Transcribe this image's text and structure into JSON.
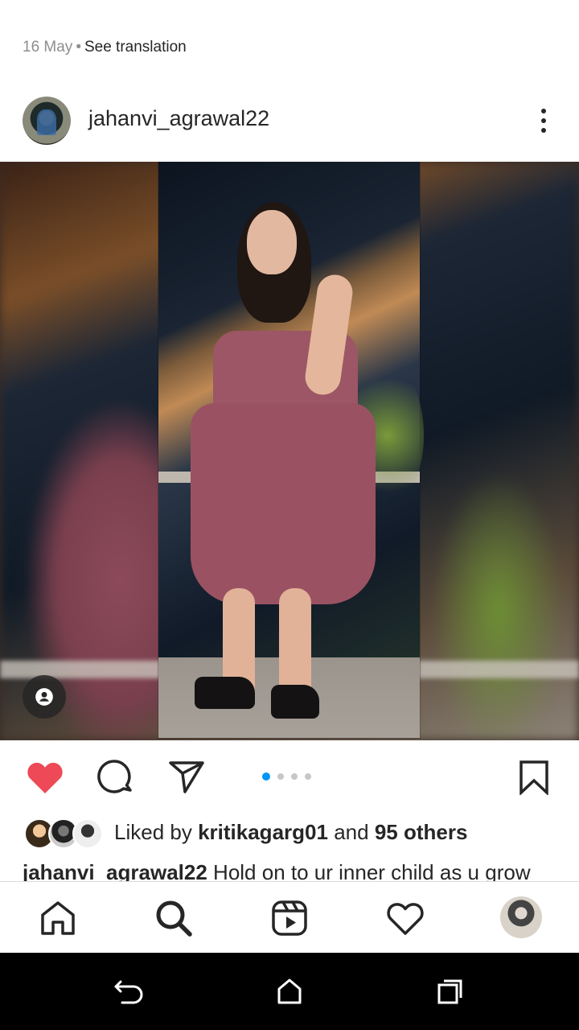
{
  "post": {
    "date": "16 May",
    "separator": "•",
    "see_translation": "See translation",
    "username": "jahanvi_agrawal22",
    "carousel": {
      "total": 4,
      "active_index": 0
    },
    "liked_by_prefix": "Liked by",
    "liked_by_user": "kritikagarg01",
    "liked_by_and": "and",
    "liked_by_others": "95 others",
    "caption_user": "jahanvi_agrawal22",
    "caption_text": "Hold on to ur inner child as u grow",
    "liked": true
  },
  "colors": {
    "like_red": "#ED4956",
    "accent_blue": "#0095F6",
    "text": "#262626",
    "muted": "#8E8E8E"
  },
  "icons": {
    "more": "more-vertical-icon",
    "tag": "user-tag-icon",
    "like": "heart-filled-icon",
    "comment": "comment-icon",
    "share": "send-icon",
    "save": "bookmark-icon",
    "home": "home-icon",
    "search": "search-icon",
    "reels": "reels-icon",
    "activity": "heart-outline-icon",
    "back": "back-icon",
    "sys_home": "home-outline-icon",
    "recents": "recents-icon"
  }
}
